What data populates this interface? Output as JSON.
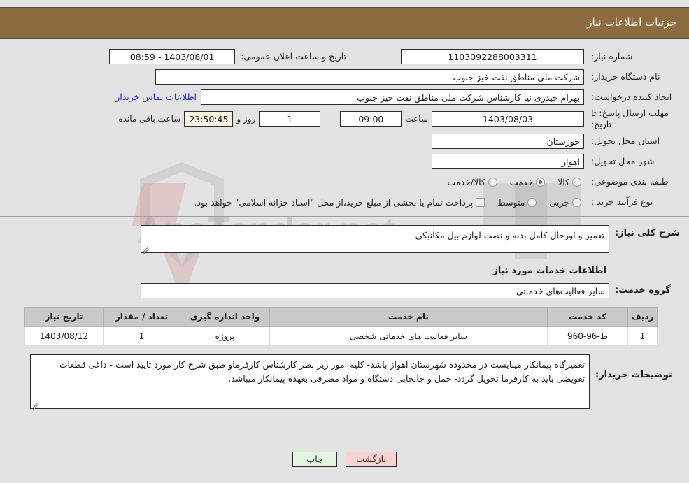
{
  "header": {
    "title": "جزئیات اطلاعات نیاز"
  },
  "fields": {
    "need_number_label": "شماره نیاز:",
    "need_number_value": "1103092288003311",
    "announce_datetime_label": "تاریخ و ساعت اعلان عمومی:",
    "announce_datetime_value": "1403/08/01 - 08:59",
    "buyer_org_label": "نام دستگاه خریدار:",
    "buyer_org_value": "شرکت ملی مناطق نفت خیز جنوب",
    "requester_label": "ایجاد کننده درخواست:",
    "requester_value": "بهرام حیدری نیا کارشناس شرکت ملی مناطق نفت خیز جنوب",
    "contact_link": "اطلاعات تماس خریدار",
    "deadline_label": "مهلت ارسال پاسخ: تا تاریخ:",
    "deadline_date": "1403/08/03",
    "deadline_hour_label": "ساعت",
    "deadline_hour": "09:00",
    "remaining_days": "1",
    "remaining_days_label": "روز و",
    "remaining_time": "23:50:45",
    "remaining_time_label": "ساعت باقی مانده",
    "province_label": "استان محل تحویل:",
    "province_value": "خوزستان",
    "city_label": "شهر محل تحویل:",
    "city_value": "اهواز",
    "category_label": "طبقه بندی موضوعی:",
    "process_label": "نوع فرآیند خرید :"
  },
  "category_options": [
    {
      "label": "کالا",
      "selected": false
    },
    {
      "label": "خدمت",
      "selected": true
    },
    {
      "label": "کالا/خدمت",
      "selected": false
    }
  ],
  "process_options": [
    {
      "label": "جزیی",
      "selected": false
    },
    {
      "label": "متوسط",
      "selected": false
    }
  ],
  "treasury": {
    "checked": false,
    "text": "پرداخت تمام یا بخشی از مبلغ خرید،از محل \"اسناد خزانه اسلامی\" خواهد بود."
  },
  "description": {
    "label": "شرح کلی نیاز:",
    "value": "تعمیر و اورحال کامل بدنه و نصب لوازم بیل مکانیکی"
  },
  "services_section": {
    "heading": "اطلاعات خدمات مورد نیاز",
    "group_label": "گروه خدمت:",
    "group_value": "سایر فعالیت‌های خدماتی"
  },
  "table": {
    "columns": [
      "ردیف",
      "کد خدمت",
      "نام خدمت",
      "واحد اندازه گیری",
      "تعداد / مقدار",
      "تاریخ نیاز"
    ],
    "rows": [
      {
        "row_no": "1",
        "service_code": "ط-96-960",
        "service_name": "سایر فعالیت های خدماتی شخصی",
        "unit": "پروژه",
        "quantity": "1",
        "need_date": "1403/08/12"
      }
    ]
  },
  "buyer_notes": {
    "label": "توضیحات خریدار:",
    "value": "تعمیرگاه پیمانکار میبایست در محدوده شهرستان اهواز باشد- کلیه امور زیر نظر کارشناس کارفرماو طبق شرح کار مورد تایید است - داغی قطعات تعویضی باید به کارفرما تحویل گردد- حمل و جابجایی دستگاه و مواد مصرفی بعهده پیمانکار میباشد."
  },
  "buttons": {
    "back": "بازگشت",
    "print": "چاپ"
  },
  "watermark": {
    "text": "AnaTender.net"
  },
  "colors": {
    "header_bg": "#8c6b3f",
    "page_bg": "#e3e3e3",
    "link": "#2222cc",
    "countdown_bg": "#fbf8e3",
    "back_btn_bg": "#fbd3d3",
    "print_btn_bg": "#e4f5e0",
    "table_header_bg": "#c9c9c9"
  }
}
